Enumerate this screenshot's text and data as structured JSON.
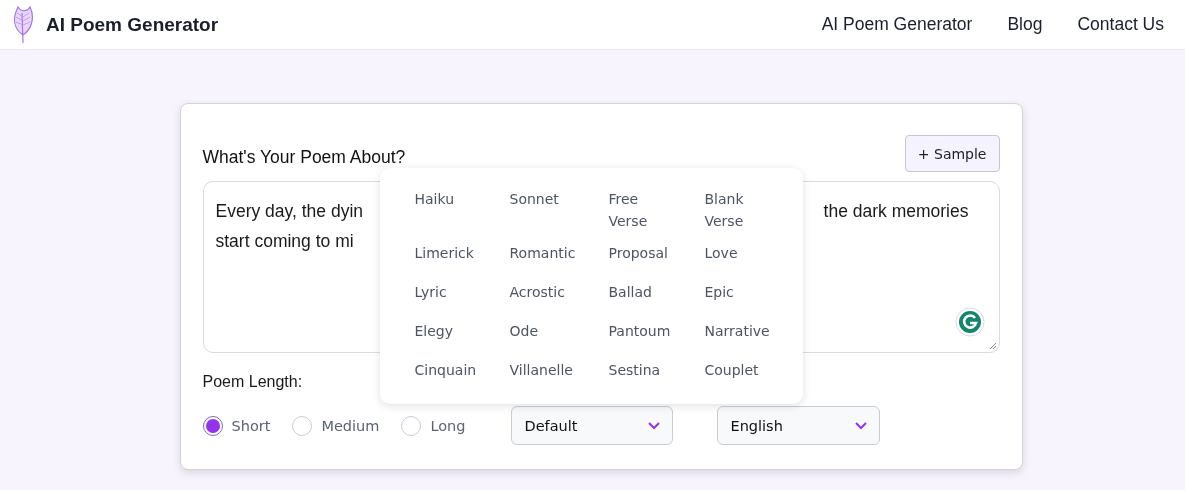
{
  "header": {
    "brand": "AI Poem Generator",
    "nav": [
      {
        "label": "AI Poem Generator"
      },
      {
        "label": "Blog"
      },
      {
        "label": "Contact Us"
      }
    ]
  },
  "form": {
    "prompt_label": "What's Your Poem About?",
    "sample_button": "+ Sample",
    "textarea_lines": [
      {
        "left": "Every day, the dyin",
        "right": "the dark memories"
      },
      {
        "left": "start coming to mi"
      }
    ],
    "length_label": "Poem Length:",
    "lengths": [
      {
        "label": "Short",
        "selected": true
      },
      {
        "label": "Medium",
        "selected": false
      },
      {
        "label": "Long",
        "selected": false
      }
    ],
    "style_select": {
      "value": "Default"
    },
    "language_select": {
      "value": "English"
    }
  },
  "style_menu": {
    "options": [
      {
        "label": "Haiku"
      },
      {
        "label": "Sonnet"
      },
      {
        "label": "Free Verse"
      },
      {
        "label": "Blank Verse"
      },
      {
        "label": "Limerick"
      },
      {
        "label": "Romantic"
      },
      {
        "label": "Proposal"
      },
      {
        "label": "Love"
      },
      {
        "label": "Lyric"
      },
      {
        "label": "Acrostic"
      },
      {
        "label": "Ballad"
      },
      {
        "label": "Epic"
      },
      {
        "label": "Elegy"
      },
      {
        "label": "Ode"
      },
      {
        "label": "Pantoum"
      },
      {
        "label": "Narrative"
      },
      {
        "label": "Cinquain"
      },
      {
        "label": "Villanelle"
      },
      {
        "label": "Sestina"
      },
      {
        "label": "Couplet"
      }
    ]
  }
}
